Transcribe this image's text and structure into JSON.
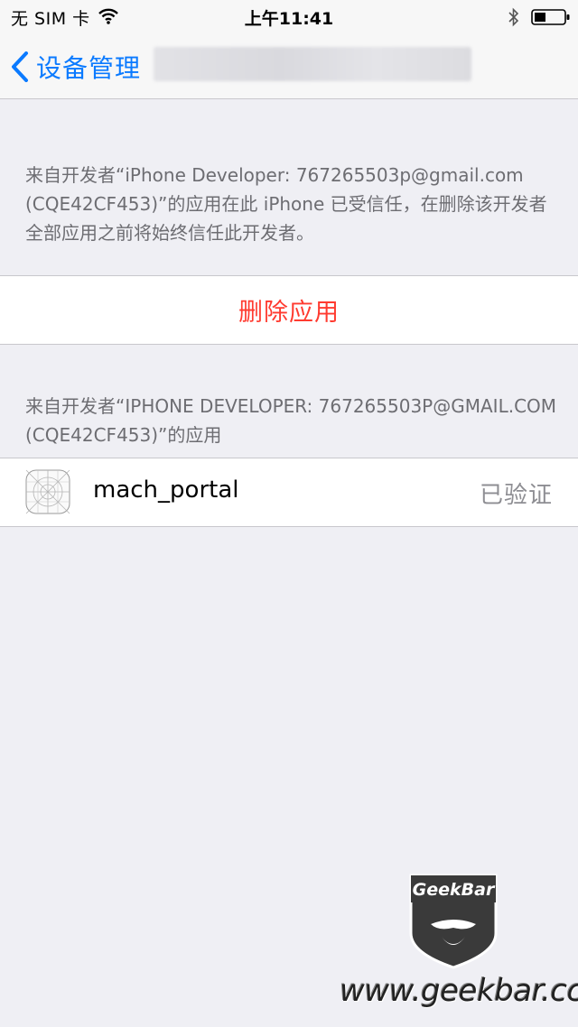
{
  "status_bar": {
    "carrier": "无 SIM 卡",
    "time": "上午11:41",
    "icons": [
      "wifi-icon",
      "bluetooth-icon",
      "battery-icon"
    ]
  },
  "nav": {
    "back_label": "设备管理",
    "back_icon": "chevron-left-icon"
  },
  "trust_section": {
    "description": "来自开发者“iPhone Developer: 767265503p@gmail.com (CQE42CF453)”的应用在此 iPhone 已受信任，在删除该开发者全部应用之前将始终信任此开发者。"
  },
  "delete_button": {
    "label": "删除应用",
    "color": "#ff3b30"
  },
  "apps_section": {
    "header": "来自开发者“IPHONE DEVELOPER: 767265503P@GMAIL.COM (CQE42CF453)”的应用",
    "apps": [
      {
        "name": "mach_portal",
        "status": "已验证",
        "icon": "app-placeholder-icon"
      }
    ]
  },
  "watermark": {
    "logo_text": "GeekBar",
    "url": "www.geekbar.cc"
  },
  "colors": {
    "accent": "#0a7aff",
    "background": "#efeff4",
    "secondary_text": "#6d6d72"
  }
}
